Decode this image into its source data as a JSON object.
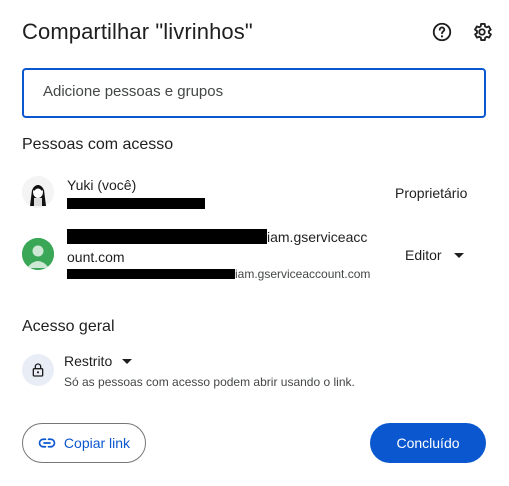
{
  "dialog": {
    "title": "Compartilhar \"livrinhos\"",
    "help_icon": "help-circle-icon",
    "settings_icon": "gear-icon"
  },
  "add_people": {
    "placeholder": "Adicione pessoas e grupos"
  },
  "people_section": {
    "title": "Pessoas com acesso",
    "people": [
      {
        "name": "Yuki (você)",
        "role": "Proprietário"
      },
      {
        "name_visible_part1": "iam.gserviceacc",
        "name_visible_part2": "ount.com",
        "email_visible_part": "iam.gserviceaccount.com",
        "role": "Editor"
      }
    ]
  },
  "general_access": {
    "title": "Acesso geral",
    "selected": "Restrito",
    "description": "Só as pessoas com acesso podem abrir usando o link."
  },
  "footer": {
    "copy_link_label": "Copiar link",
    "done_label": "Concluído"
  },
  "colors": {
    "accent": "#0b57d0",
    "service_avatar": "#3aa757"
  }
}
